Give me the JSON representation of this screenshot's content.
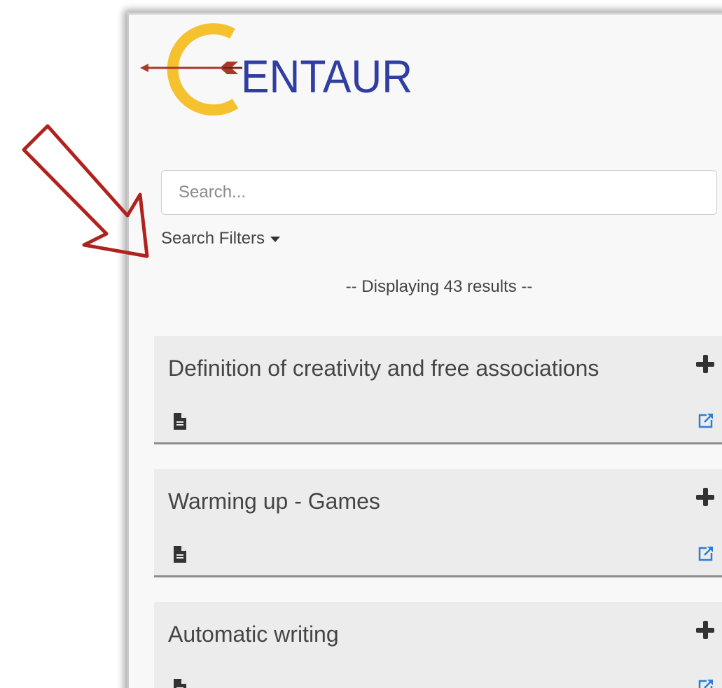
{
  "logo": {
    "text": "ENTAUR"
  },
  "search": {
    "placeholder": "Search...",
    "value": ""
  },
  "filters": {
    "label": "Search Filters"
  },
  "results": {
    "count_text": "-- Displaying 43 results --"
  },
  "cards": [
    {
      "title": "Definition of creativity and free associations"
    },
    {
      "title": "Warming up - Games"
    },
    {
      "title": "Automatic writing"
    }
  ],
  "icons": {
    "expand": "plus-icon",
    "document": "document-icon",
    "external_link": "external-link-icon",
    "annotation": "red-arrow-annotation"
  },
  "colors": {
    "logo_blue": "#2f3ea0",
    "logo_gold": "#f5c12f",
    "arrow_red": "#b0221e",
    "link_blue": "#2a7fd4"
  }
}
